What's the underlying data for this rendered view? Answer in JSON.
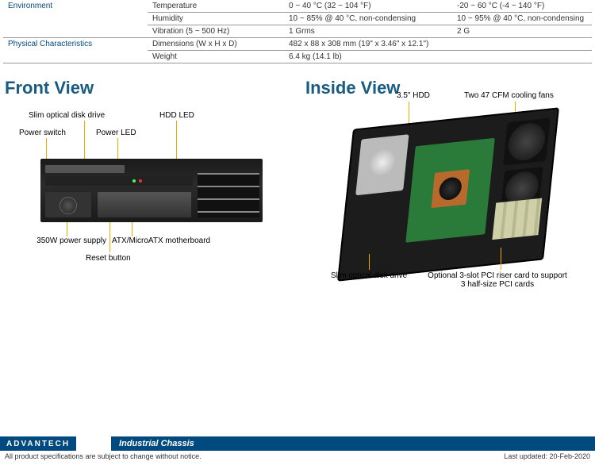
{
  "specs": {
    "env_category": "Environment",
    "phys_category": "Physical Characteristics",
    "rows": {
      "temp": {
        "label": "Temperature",
        "op": "0 ~ 40 °C (32 ~ 104 °F)",
        "nonop": "-20 ~ 60 °C (-4 ~ 140 °F)"
      },
      "hum": {
        "label": "Humidity",
        "op": "10 ~ 85% @ 40 °C, non-condensing",
        "nonop": "10 ~ 95% @ 40 °C, non-condensing"
      },
      "vib": {
        "label": "Vibration (5 ~ 500 Hz)",
        "op": "1 Grms",
        "nonop": "2 G"
      },
      "dim": {
        "label": "Dimensions (W x H x D)",
        "val": "482 x 88 x 308 mm (19\" x 3.46\" x 12.1\")"
      },
      "wt": {
        "label": "Weight",
        "val": "6.4 kg (14.1 lb)"
      }
    }
  },
  "headings": {
    "front": "Front View",
    "inside": "Inside View"
  },
  "front_callouts": {
    "slim_odd": "Slim optical disk drive",
    "hdd_led": "HDD LED",
    "power_switch": "Power switch",
    "power_led": "Power LED",
    "psu": "350W power supply",
    "mb": "ATX/MicroATX motherboard",
    "reset": "Reset button"
  },
  "inside_callouts": {
    "hdd": "3.5\" HDD",
    "fans": "Two 47 CFM cooling fans",
    "slim_odd": "Slim optical disk drive",
    "riser": "Optional 3-slot PCI riser card to support 3 half-size PCI cards"
  },
  "footer": {
    "brand": "ADVANTECH",
    "category": "Industrial Chassis",
    "notice": "All product specifications are subject to change without notice.",
    "updated": "Last updated: 20-Feb-2020"
  }
}
